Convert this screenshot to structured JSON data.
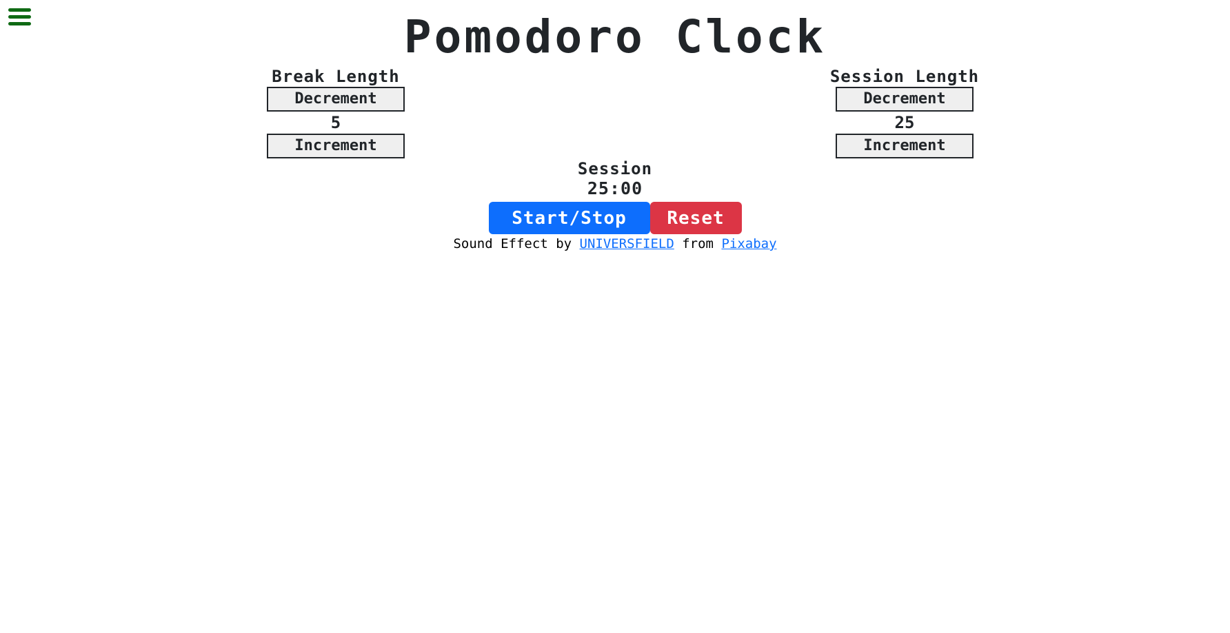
{
  "header": {
    "menu_icon": "hamburger-menu-icon",
    "menu_color": "#0f6a14",
    "title": "Pomodoro Clock"
  },
  "break": {
    "label": "Break Length",
    "decrement_label": "Decrement",
    "value": "5",
    "increment_label": "Increment"
  },
  "session": {
    "label": "Session Length",
    "decrement_label": "Decrement",
    "value": "25",
    "increment_label": "Increment"
  },
  "timer": {
    "label": "Session",
    "time_left": "25:00"
  },
  "actions": {
    "start_stop_label": "Start/Stop",
    "start_stop_color": "#0d6efd",
    "reset_label": "Reset",
    "reset_color": "#dc3545"
  },
  "credit": {
    "prefix": "Sound Effect by ",
    "author": "UNIVERSFIELD",
    "middle": " from ",
    "source": "Pixabay"
  }
}
